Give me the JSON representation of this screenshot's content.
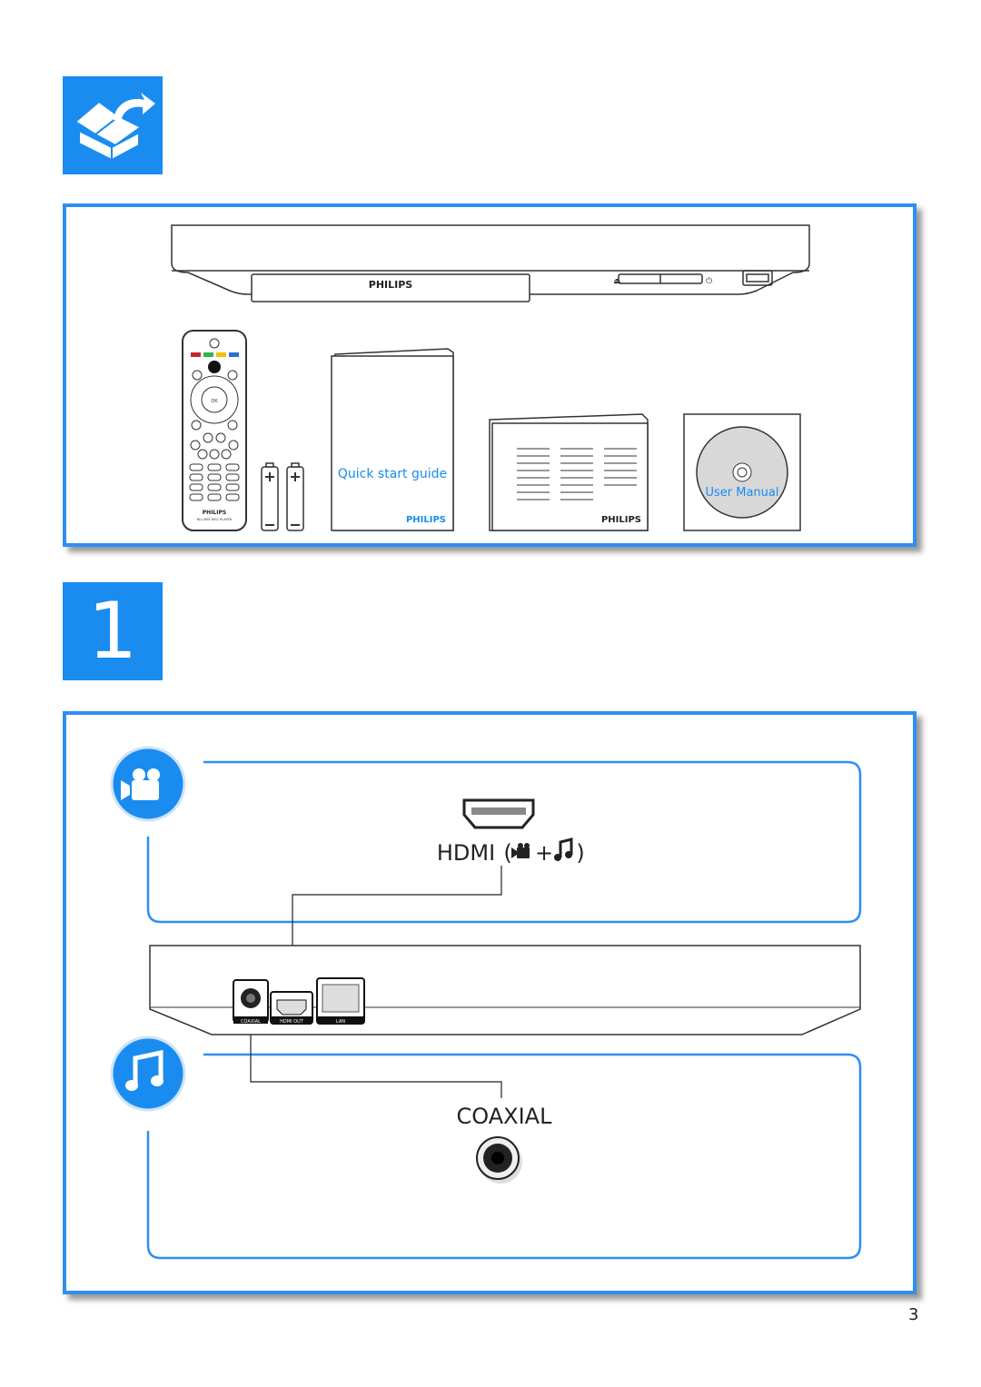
{
  "header_icon": "unpack-box-icon",
  "accent_color": "#1a8cf0",
  "box_contents": {
    "player_brand": "PHILIPS",
    "remote": {
      "ok_label": "OK",
      "brand": "PHILIPS",
      "model": "BLU-RAY DISC PLAYER"
    },
    "quick_start_guide": {
      "title": "Quick start guide",
      "brand": "PHILIPS"
    },
    "booklet": {
      "brand": "PHILIPS"
    },
    "disc": {
      "label": "User Manual"
    }
  },
  "step": {
    "number": "1"
  },
  "connection": {
    "video_icon": "video-camera-icon",
    "audio_icon": "music-note-icon",
    "hdmi_label": "HDMI",
    "hdmi_suffix_open": "(",
    "hdmi_plus": "+",
    "hdmi_suffix_close": ")",
    "coaxial_label": "COAXIAL",
    "ports": [
      "COAXIAL",
      "HDMI OUT",
      "LAN"
    ]
  },
  "page_number": "3"
}
